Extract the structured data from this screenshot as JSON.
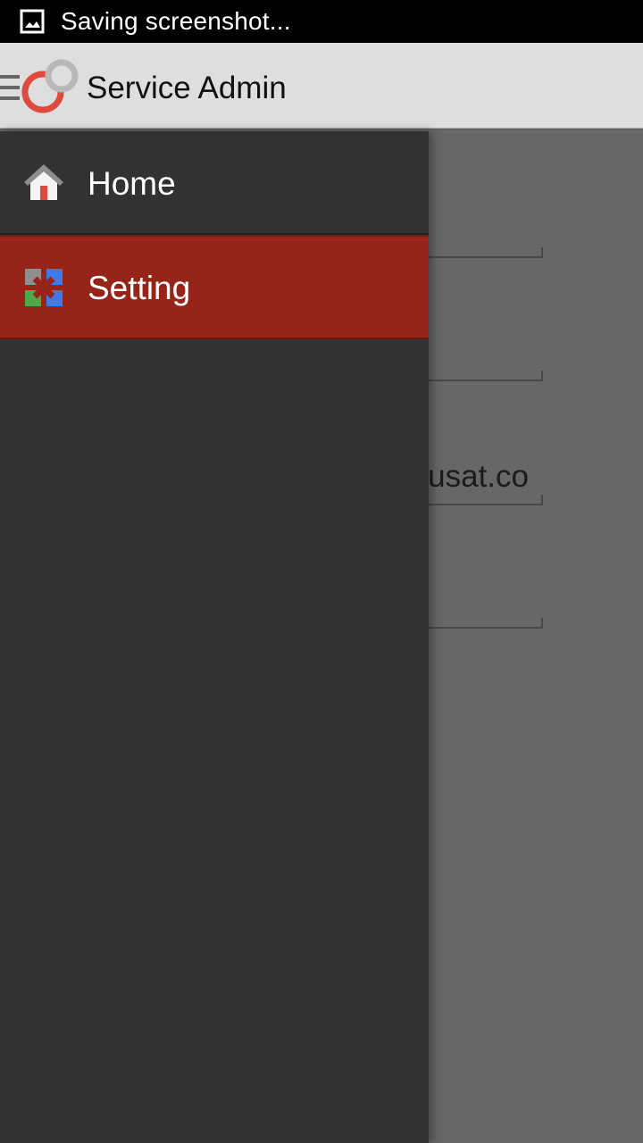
{
  "status_bar": {
    "text": "Saving screenshot...",
    "icon": "image-icon"
  },
  "app_bar": {
    "title": "Service Admin",
    "menu_icon": "menu-icon",
    "logo": "service-admin-logo"
  },
  "drawer": {
    "items": [
      {
        "label": "Home",
        "icon": "home-icon",
        "selected": false
      },
      {
        "label": "Setting",
        "icon": "setting-icon",
        "selected": true
      }
    ]
  },
  "background_content": {
    "fields": [
      {
        "value": ""
      },
      {
        "value": ""
      },
      {
        "value": "usat.co"
      },
      {
        "value": ""
      }
    ]
  },
  "colors": {
    "status_bar_bg": "#000000",
    "app_bar_bg": "#dedede",
    "drawer_bg": "#323232",
    "selected_item_bg": "#962418",
    "overlay_bg": "#676767"
  }
}
